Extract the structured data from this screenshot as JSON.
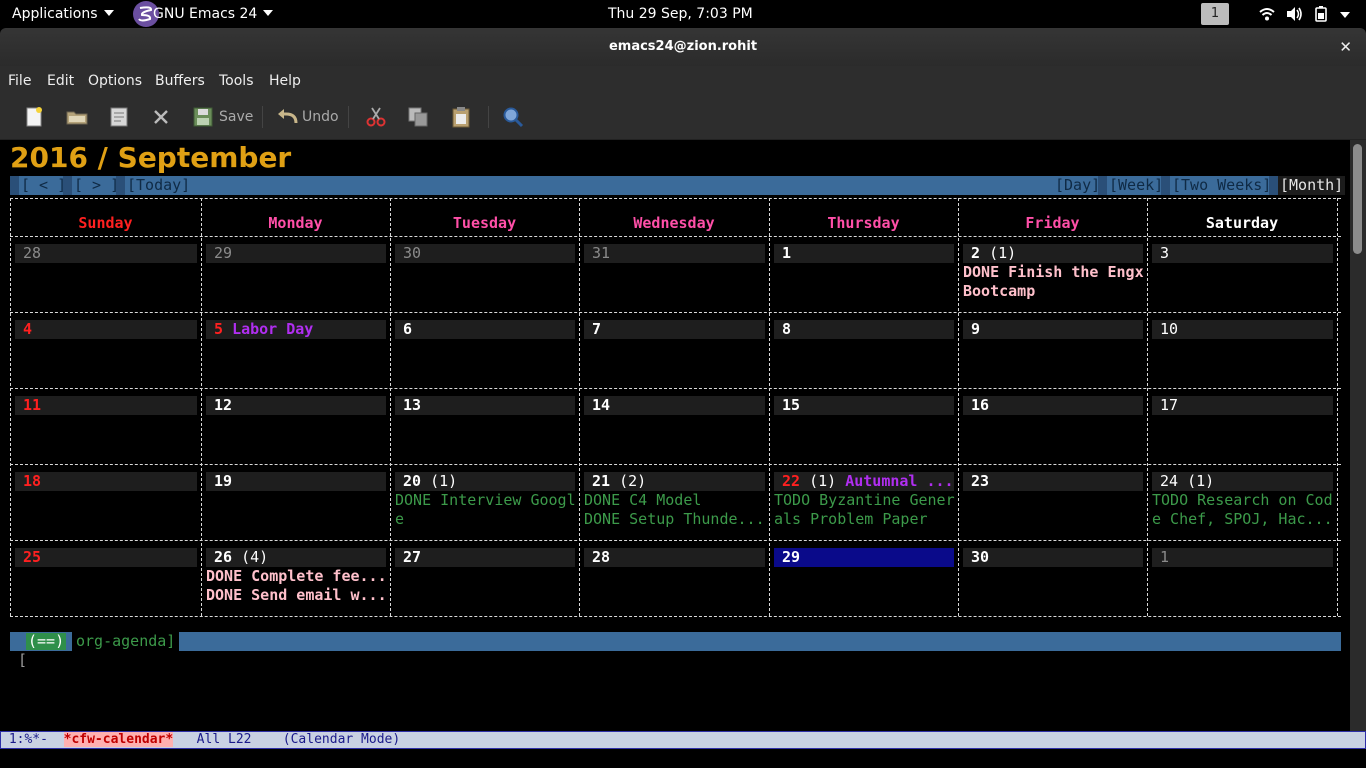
{
  "panel": {
    "applications": "Applications",
    "app_name": "GNU Emacs 24",
    "clock": "Thu 29 Sep,  7:03 PM",
    "workspace": "1"
  },
  "window": {
    "title": "emacs24@zion.rohit",
    "close": "✕"
  },
  "menubar": [
    "File",
    "Edit",
    "Options",
    "Buffers",
    "Tools",
    "Help"
  ],
  "toolbar": {
    "save_label": "Save",
    "undo_label": "Undo"
  },
  "calendar": {
    "title": "2016 / September",
    "nav": {
      "prev": "[ < ]",
      "next": "[ > ]",
      "today": "[Today]",
      "day": "[Day]",
      "week": "[Week]",
      "two_weeks": "[Two Weeks]",
      "month": "[Month]"
    },
    "weekdays": [
      "Sunday",
      "Monday",
      "Tuesday",
      "Wednesday",
      "Thursday",
      "Friday",
      "Saturday"
    ],
    "weekday_colors": [
      "#ff2020",
      "#ff4fa8",
      "#ff4fa8",
      "#ff4fa8",
      "#ff4fa8",
      "#ff4fa8",
      "#ffffff"
    ],
    "weeks": [
      [
        {
          "day": "28",
          "dim": true
        },
        {
          "day": "29",
          "dim": true
        },
        {
          "day": "30",
          "dim": true
        },
        {
          "day": "31",
          "dim": true
        },
        {
          "day": "1"
        },
        {
          "day": "2",
          "count": "(1)",
          "events": [
            {
              "text": "DONE Finish the Engx",
              "style": "done-pink"
            },
            {
              "text": "Bootcamp",
              "style": "done-pink"
            }
          ]
        },
        {
          "day": "3",
          "normal": true
        }
      ],
      [
        {
          "day": "4",
          "red": true
        },
        {
          "day": "5",
          "red": true,
          "holiday": "Labor Day"
        },
        {
          "day": "6"
        },
        {
          "day": "7"
        },
        {
          "day": "8"
        },
        {
          "day": "9"
        },
        {
          "day": "10",
          "normal": true
        }
      ],
      [
        {
          "day": "11",
          "red": true
        },
        {
          "day": "12"
        },
        {
          "day": "13"
        },
        {
          "day": "14"
        },
        {
          "day": "15"
        },
        {
          "day": "16"
        },
        {
          "day": "17",
          "normal": true
        }
      ],
      [
        {
          "day": "18",
          "red": true
        },
        {
          "day": "19"
        },
        {
          "day": "20",
          "count": "(1)",
          "events": [
            {
              "text": "DONE Interview Googl",
              "style": "done-green"
            },
            {
              "text": "e",
              "style": "done-green"
            }
          ]
        },
        {
          "day": "21",
          "count": "(2)",
          "events": [
            {
              "text": "DONE C4 Model",
              "style": "done-green"
            },
            {
              "text": "DONE Setup Thunde...",
              "style": "done-green"
            }
          ]
        },
        {
          "day": "22",
          "red": true,
          "count": "(1)",
          "holiday": "Autumnal ...",
          "events": [
            {
              "text": "TODO Byzantine Gener",
              "style": "done-green"
            },
            {
              "text": "als Problem Paper",
              "style": "done-green"
            }
          ]
        },
        {
          "day": "23"
        },
        {
          "day": "24",
          "count": "(1)",
          "normal": true,
          "events": [
            {
              "text": "TODO Research on Cod",
              "style": "done-green"
            },
            {
              "text": "e Chef, SPOJ, Hac...",
              "style": "done-green"
            }
          ]
        }
      ],
      [
        {
          "day": "25",
          "red": true
        },
        {
          "day": "26",
          "count": "(4)",
          "events": [
            {
              "text": "DONE Complete fee...",
              "style": "done-pink"
            },
            {
              "text": "DONE Send email w...",
              "style": "done-pink"
            }
          ]
        },
        {
          "day": "27"
        },
        {
          "day": "28"
        },
        {
          "day": "29",
          "today": true
        },
        {
          "day": "30"
        },
        {
          "day": "1",
          "dim": true
        }
      ]
    ],
    "agenda": {
      "bracket": "[",
      "eq": "(==)",
      "label": "org-agenda]"
    }
  },
  "modeline": {
    "status": " 1:%*-  ",
    "buffer": "*cfw-calendar*",
    "position": "   All L22    ",
    "mode": "(Calendar Mode)"
  }
}
